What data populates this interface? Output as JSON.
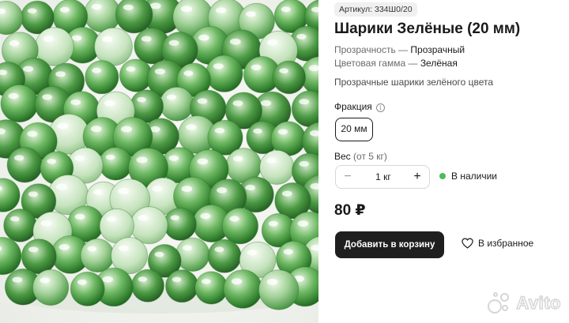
{
  "product": {
    "sku_label": "Артикул:",
    "sku": "334Ш0/20",
    "title": "Шарики Зелёные (20 мм)",
    "attributes": [
      {
        "name": "Прозрачность —",
        "value": "Прозрачный"
      },
      {
        "name": "Цветовая гамма —",
        "value": "Зелёная"
      }
    ],
    "description": "Прозрачные шарики зелёного цвета"
  },
  "fraction": {
    "label": "Фракция",
    "info_icon": "info-circle-icon",
    "selected": "20 мм"
  },
  "weight": {
    "label": "Вес",
    "hint": "(от 5 кг)",
    "minus": "−",
    "quantity": "1 кг",
    "plus": "+"
  },
  "stock": {
    "text": "В наличии",
    "color": "#4cbb5c"
  },
  "price": "80 ₽",
  "actions": {
    "add_to_cart": "Добавить в корзину",
    "favorite": "В избранное",
    "favorite_icon": "heart-icon"
  },
  "branding": {
    "watermark": "Avito"
  }
}
